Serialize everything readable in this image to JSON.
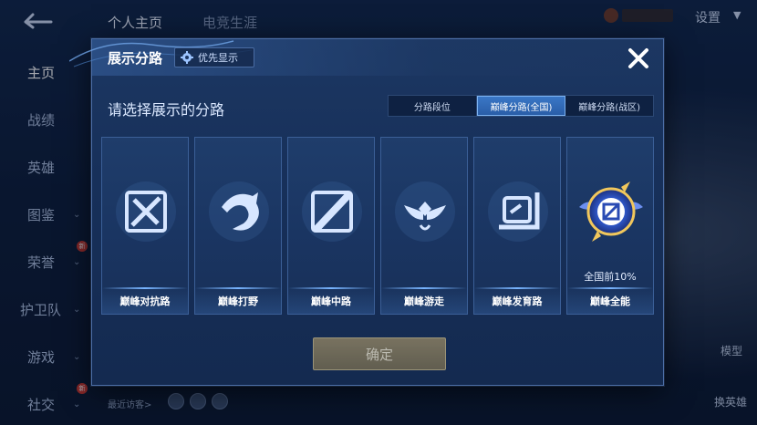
{
  "background": {
    "top_tabs": [
      "个人主页",
      "电竞生涯"
    ],
    "settings_label": "设置",
    "side_menu": [
      {
        "label": "主页",
        "has_chevron": false,
        "new_badge": ""
      },
      {
        "label": "战绩",
        "has_chevron": false,
        "new_badge": ""
      },
      {
        "label": "英雄",
        "has_chevron": false,
        "new_badge": ""
      },
      {
        "label": "图鉴",
        "has_chevron": true,
        "new_badge": ""
      },
      {
        "label": "荣誉",
        "has_chevron": true,
        "new_badge": "新"
      },
      {
        "label": "护卫队",
        "has_chevron": true,
        "new_badge": ""
      },
      {
        "label": "游戏",
        "has_chevron": true,
        "new_badge": ""
      },
      {
        "label": "社交",
        "has_chevron": true,
        "new_badge": "新"
      }
    ],
    "right_labels": [
      "模型",
      "换英雄"
    ],
    "recent_visitors_label": "最近访客>"
  },
  "modal": {
    "title": "展示分路",
    "priority_button": "优先显示",
    "prompt": "请选择展示的分路",
    "tabs": [
      {
        "label": "分路段位",
        "active": false
      },
      {
        "label": "巅峰分路(全国)",
        "active": true
      },
      {
        "label": "巅峰分路(战区)",
        "active": false
      }
    ],
    "cards": [
      {
        "label": "巅峰对抗路",
        "icon": "sword-shield-icon",
        "sub": ""
      },
      {
        "label": "巅峰打野",
        "icon": "dragon-icon",
        "sub": ""
      },
      {
        "label": "巅峰中路",
        "icon": "slash-icon",
        "sub": ""
      },
      {
        "label": "巅峰游走",
        "icon": "wings-icon",
        "sub": ""
      },
      {
        "label": "巅峰发育路",
        "icon": "bow-target-icon",
        "sub": ""
      },
      {
        "label": "巅峰全能",
        "icon": "all-round-emblem-icon",
        "sub": "全国前10%"
      }
    ],
    "confirm_button": "确定"
  },
  "colors": {
    "accent": "#3a77c6",
    "panel": "#1a3562",
    "confirm": "#7a7058"
  }
}
